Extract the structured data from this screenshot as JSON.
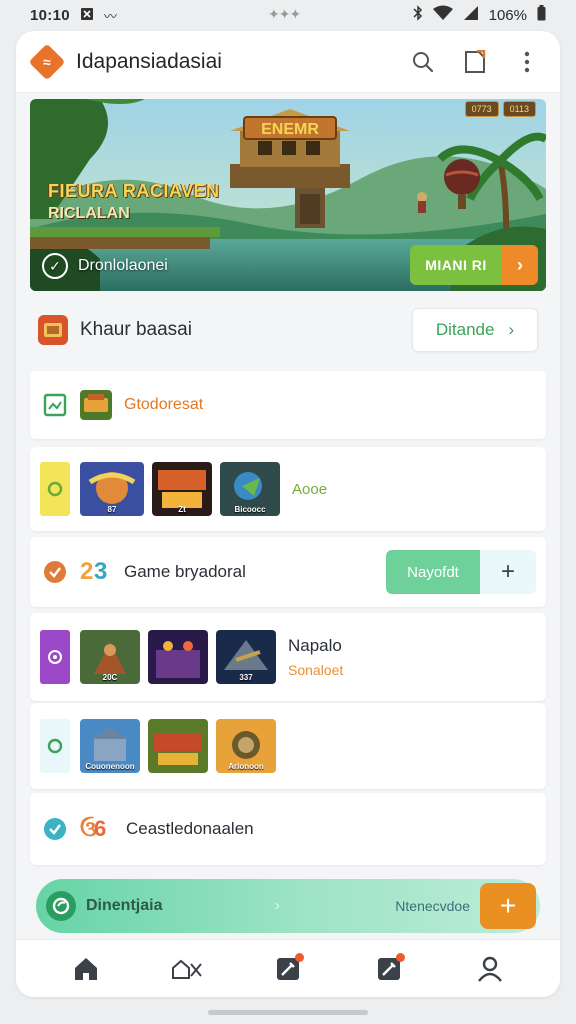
{
  "status_bar": {
    "time": "10:10",
    "battery": "106%"
  },
  "header": {
    "title": "Idapansiadasiai"
  },
  "hero": {
    "title": "FIEURA RACIAVEN",
    "subtitle": "RICLALAN",
    "check_label": "Dronlolaonei",
    "button_label": "MIANI RI",
    "sign_text": "ENEMR",
    "hud": [
      "0773",
      "0113"
    ]
  },
  "section": {
    "title": "Khaur baasai",
    "button_label": "Ditande"
  },
  "cards": {
    "c1": {
      "name": "Gtodoresat"
    },
    "c2": {
      "thumbs": [
        {
          "caption": "87"
        },
        {
          "caption": "Zt"
        },
        {
          "caption": "Bicoocc"
        }
      ],
      "label": "Aooe"
    },
    "c3": {
      "text": "Game bryadoral",
      "button_label": "Nayofdt",
      "plus": "+"
    },
    "c4": {
      "thumbs": [
        {
          "caption": "20C"
        },
        {
          "caption": ""
        },
        {
          "caption": "337"
        }
      ],
      "title": "Napalo",
      "subtitle": "Sonaloet"
    },
    "c5": {
      "thumbs": [
        {
          "caption": "Couonenoon"
        },
        {
          "caption": ""
        },
        {
          "caption": "Arlonoon"
        }
      ]
    },
    "c6": {
      "text": "Ceastledonaalen"
    }
  },
  "cta": {
    "title": "Dinentjaia",
    "text": "Ntenecvdoe",
    "plus": "+"
  },
  "colors": {
    "accent_orange": "#e9732a",
    "accent_green": "#7cc040",
    "mint": "#6fd19a",
    "purple": "#9b49c9",
    "yellow": "#f3e45a"
  }
}
